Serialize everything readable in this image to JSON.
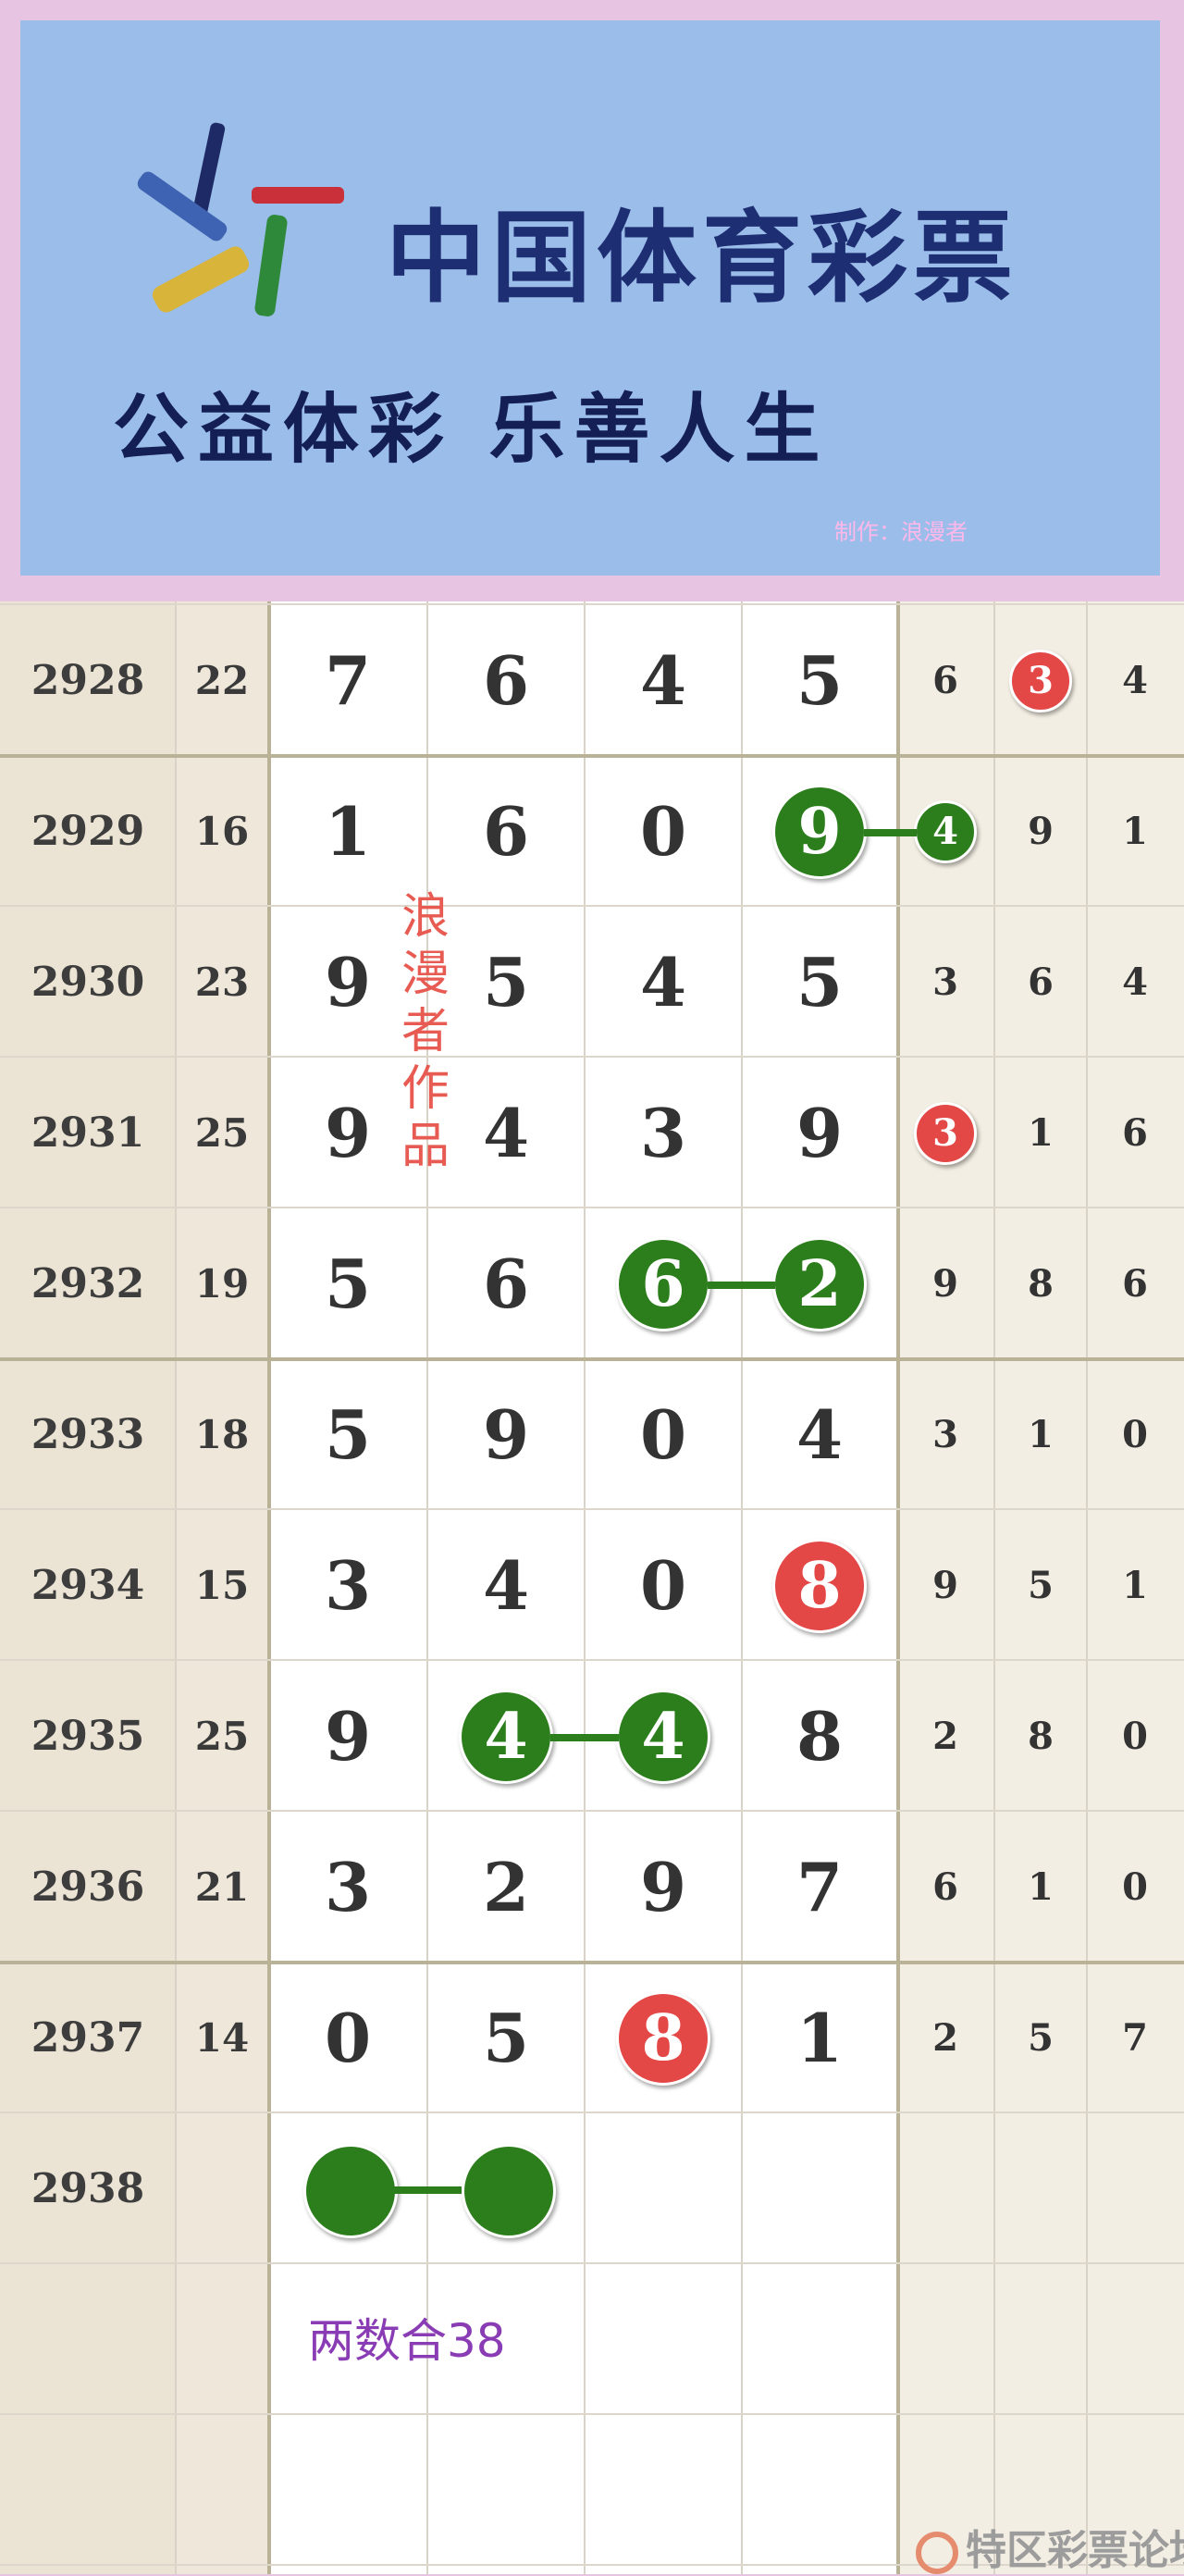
{
  "banner": {
    "title": "中国体育彩票",
    "slogan": "公益体彩 乐善人生",
    "maker": "制作：浪漫者"
  },
  "colors": {
    "green_ball": "#2c7e1c",
    "red_ball": "#e34746",
    "note_purple": "#8a3cb4",
    "author_red": "#e85b52"
  },
  "rows": [
    {
      "issue": "2928",
      "sum": "22",
      "main": [
        "7",
        "6",
        "4",
        "5"
      ],
      "extra": [
        "6",
        "3",
        "4"
      ],
      "red_extra": [
        1
      ]
    },
    {
      "issue": "2929",
      "sum": "16",
      "main": [
        "1",
        "6",
        "0",
        "9"
      ],
      "extra": [
        "4",
        "9",
        "1"
      ],
      "green_main": [
        3
      ],
      "green_extra": [
        0
      ]
    },
    {
      "issue": "2930",
      "sum": "23",
      "main": [
        "9",
        "5",
        "4",
        "5"
      ],
      "extra": [
        "3",
        "6",
        "4"
      ]
    },
    {
      "issue": "2931",
      "sum": "25",
      "main": [
        "9",
        "4",
        "3",
        "9"
      ],
      "extra": [
        "3",
        "1",
        "6"
      ],
      "red_extra": [
        0
      ]
    },
    {
      "issue": "2932",
      "sum": "19",
      "main": [
        "5",
        "6",
        "6",
        "2"
      ],
      "extra": [
        "9",
        "8",
        "6"
      ],
      "green_main": [
        2,
        3
      ]
    },
    {
      "issue": "2933",
      "sum": "18",
      "main": [
        "5",
        "9",
        "0",
        "4"
      ],
      "extra": [
        "3",
        "1",
        "0"
      ]
    },
    {
      "issue": "2934",
      "sum": "15",
      "main": [
        "3",
        "4",
        "0",
        "8"
      ],
      "extra": [
        "9",
        "5",
        "1"
      ],
      "red_main": [
        3
      ]
    },
    {
      "issue": "2935",
      "sum": "25",
      "main": [
        "9",
        "4",
        "4",
        "8"
      ],
      "extra": [
        "2",
        "8",
        "0"
      ],
      "green_main": [
        1,
        2
      ]
    },
    {
      "issue": "2936",
      "sum": "21",
      "main": [
        "3",
        "2",
        "9",
        "7"
      ],
      "extra": [
        "6",
        "1",
        "0"
      ]
    },
    {
      "issue": "2937",
      "sum": "14",
      "main": [
        "0",
        "5",
        "8",
        "1"
      ],
      "extra": [
        "2",
        "5",
        "7"
      ],
      "red_main": [
        2
      ]
    },
    {
      "issue": "2938",
      "sum": "",
      "main": [
        "",
        "",
        "",
        ""
      ],
      "extra": [
        "",
        "",
        ""
      ],
      "prediction_balls": [
        0,
        1
      ]
    }
  ],
  "author_text": "浪漫者作品",
  "prediction_note": "两数合38",
  "watermark": "特区彩票论坛"
}
